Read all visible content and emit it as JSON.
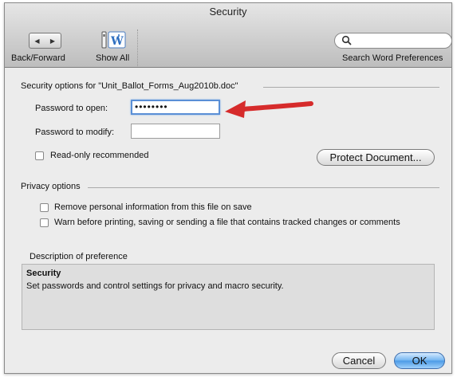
{
  "window": {
    "title": "Security"
  },
  "toolbar": {
    "back_forward_label": "Back/Forward",
    "show_all_label": "Show All",
    "search_placeholder": "",
    "search_label": "Search Word Preferences"
  },
  "security": {
    "section_title": "Security options for \"Unit_Ballot_Forms_Aug2010b.doc\"",
    "password_open_label": "Password to open:",
    "password_open_value": "••••••••",
    "password_modify_label": "Password to modify:",
    "password_modify_value": "",
    "readonly_label": "Read-only recommended",
    "protect_button": "Protect Document..."
  },
  "privacy": {
    "section_title": "Privacy options",
    "remove_info_label": "Remove personal information from this file on save",
    "warn_label": "Warn before printing, saving or sending a file that contains tracked changes or comments"
  },
  "description": {
    "section_title": "Description of preference",
    "heading": "Security",
    "text": "Set passwords and control settings for privacy and macro security."
  },
  "buttons": {
    "cancel": "Cancel",
    "ok": "OK"
  },
  "colors": {
    "focus_ring": "#5a8fd6",
    "arrow": "#d62b2b",
    "default_button": "#4a9ae6"
  },
  "icons": [
    "back-icon",
    "forward-icon",
    "show-all-icon",
    "search-icon"
  ]
}
